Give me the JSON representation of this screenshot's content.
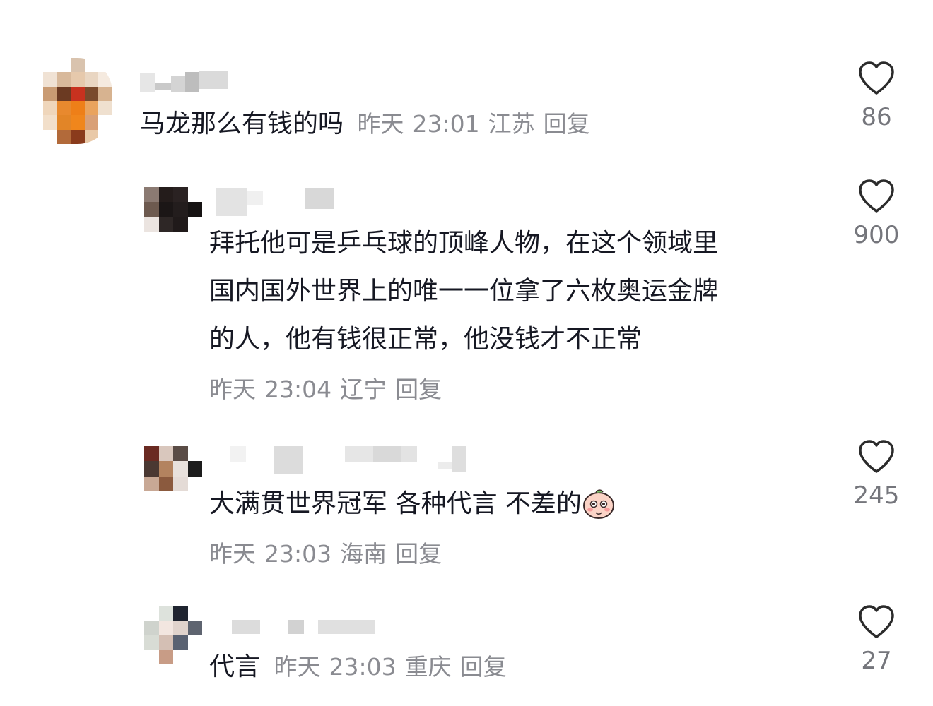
{
  "comments": [
    {
      "text": "马龙那么有钱的吗",
      "date": "昨天",
      "time": "23:01",
      "location": "江苏",
      "reply_label": "回复",
      "likes": "86"
    },
    {
      "lines": [
        "拜托他可是乒乓球的顶峰人物，在这个领域里",
        "国内国外世界上的唯一一位拿了六枚奥运金牌",
        "的人，他有钱很正常，他没钱才不正常"
      ],
      "date": "昨天",
      "time": "23:04",
      "location": "辽宁",
      "reply_label": "回复",
      "likes": "900"
    },
    {
      "text": "大满贯世界冠军 各种代言 不差的",
      "emoji": "peach-emoji",
      "date": "昨天",
      "time": "23:03",
      "location": "海南",
      "reply_label": "回复",
      "likes": "245"
    },
    {
      "text": "代言",
      "date": "昨天",
      "time": "23:03",
      "location": "重庆",
      "reply_label": "回复",
      "likes": "27"
    }
  ],
  "icons": {
    "like": "heart-outline-icon"
  },
  "colors": {
    "text": "#161823",
    "meta": "#8a8b91",
    "count": "#75767c"
  }
}
